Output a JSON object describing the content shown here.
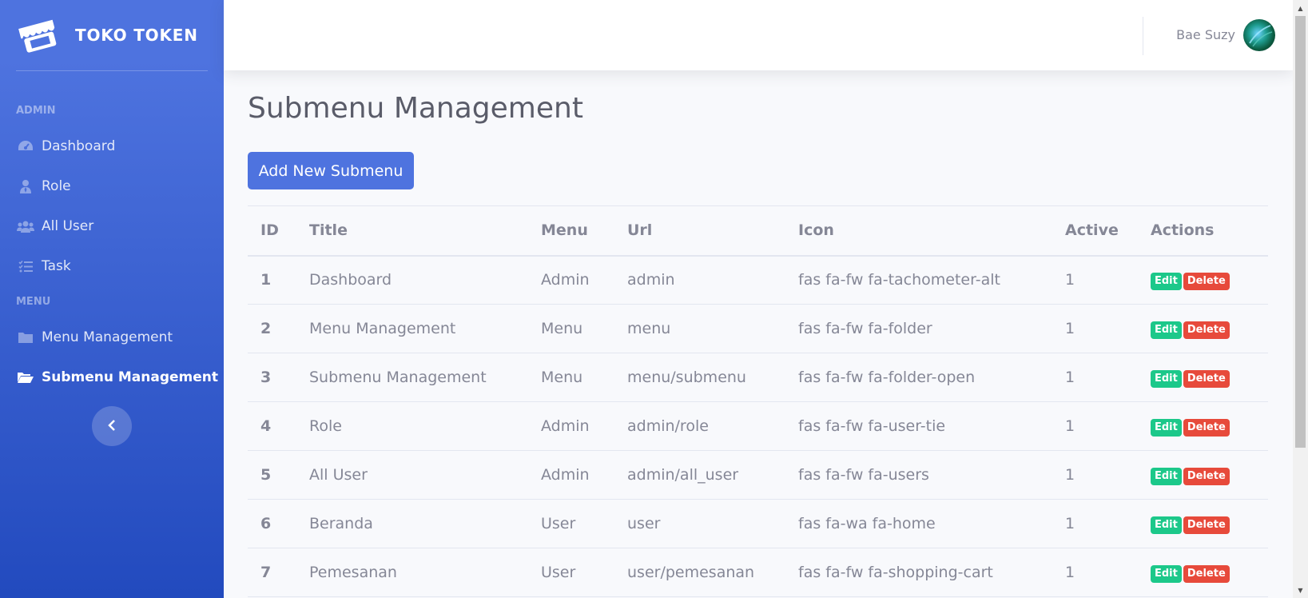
{
  "sidebar": {
    "brand": "TOKO TOKEN",
    "sections": [
      {
        "heading": "ADMIN",
        "items": [
          {
            "label": "Dashboard",
            "icon": "tachometer-icon",
            "active": false
          },
          {
            "label": "Role",
            "icon": "user-tie-icon",
            "active": false
          },
          {
            "label": "All User",
            "icon": "users-icon",
            "active": false
          },
          {
            "label": "Task",
            "icon": "tasks-icon",
            "active": false
          }
        ]
      },
      {
        "heading": "MENU",
        "items": [
          {
            "label": "Menu Management",
            "icon": "folder-icon",
            "active": false
          },
          {
            "label": "Submenu Management",
            "icon": "folder-open-icon",
            "active": true
          }
        ]
      }
    ]
  },
  "topbar": {
    "user_name": "Bae Suzy"
  },
  "main": {
    "title": "Submenu Management",
    "add_button": "Add New Submenu",
    "table": {
      "columns": [
        "ID",
        "Title",
        "Menu",
        "Url",
        "Icon",
        "Active",
        "Actions"
      ],
      "rows": [
        {
          "id": "1",
          "title": "Dashboard",
          "menu": "Admin",
          "url": "admin",
          "icon": "fas fa-fw fa-tachometer-alt",
          "active": "1"
        },
        {
          "id": "2",
          "title": "Menu Management",
          "menu": "Menu",
          "url": "menu",
          "icon": "fas fa-fw fa-folder",
          "active": "1"
        },
        {
          "id": "3",
          "title": "Submenu Management",
          "menu": "Menu",
          "url": "menu/submenu",
          "icon": "fas fa-fw fa-folder-open",
          "active": "1"
        },
        {
          "id": "4",
          "title": "Role",
          "menu": "Admin",
          "url": "admin/role",
          "icon": "fas fa-fw fa-user-tie",
          "active": "1"
        },
        {
          "id": "5",
          "title": "All User",
          "menu": "Admin",
          "url": "admin/all_user",
          "icon": "fas fa-fw fa-users",
          "active": "1"
        },
        {
          "id": "6",
          "title": "Beranda",
          "menu": "User",
          "url": "user",
          "icon": "fas fa-wa fa-home",
          "active": "1"
        },
        {
          "id": "7",
          "title": "Pemesanan",
          "menu": "User",
          "url": "user/pemesanan",
          "icon": "fas fa-fw fa-shopping-cart",
          "active": "1"
        }
      ],
      "edit_label": "Edit",
      "delete_label": "Delete"
    }
  },
  "colors": {
    "primary": "#4e73df",
    "success": "#1cc88a",
    "danger": "#e74a3b",
    "text": "#858796"
  }
}
